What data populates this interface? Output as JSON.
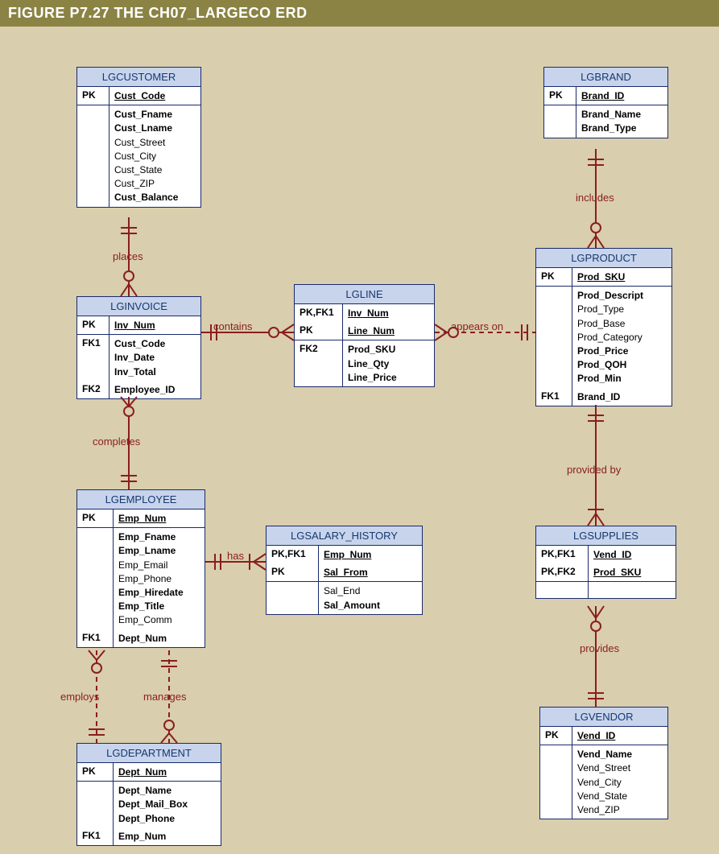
{
  "title": "FIGURE P7.27  THE CH07_LARGECO ERD",
  "entities": {
    "lgcustomer": {
      "name": "LGCUSTOMER",
      "pk": {
        "key": "PK",
        "attr": "Cust_Code"
      },
      "body": [
        {
          "key": "",
          "attrs": [
            {
              "t": "Cust_Fname",
              "b": true
            },
            {
              "t": "Cust_Lname",
              "b": true
            },
            {
              "t": "Cust_Street"
            },
            {
              "t": "Cust_City"
            },
            {
              "t": "Cust_State"
            },
            {
              "t": "Cust_ZIP"
            },
            {
              "t": "Cust_Balance",
              "b": true
            }
          ]
        }
      ]
    },
    "lginvoice": {
      "name": "LGINVOICE",
      "pk": {
        "key": "PK",
        "attr": "Inv_Num"
      },
      "body": [
        {
          "key": "FK1",
          "attrs": [
            {
              "t": "Cust_Code",
              "b": true
            },
            {
              "t": "Inv_Date",
              "b": true
            },
            {
              "t": "Inv_Total",
              "b": true
            }
          ]
        },
        {
          "key": "FK2",
          "attrs": [
            {
              "t": "Employee_ID",
              "b": true
            }
          ]
        }
      ]
    },
    "lgline": {
      "name": "LGLINE",
      "pk": [
        {
          "key": "PK,FK1",
          "attr": "Inv_Num"
        },
        {
          "key": "PK",
          "attr": "Line_Num"
        }
      ],
      "body": [
        {
          "key": "FK2",
          "attrs": [
            {
              "t": "Prod_SKU",
              "b": true
            },
            {
              "t": "Line_Qty",
              "b": true
            },
            {
              "t": "Line_Price",
              "b": true
            }
          ]
        }
      ]
    },
    "lgbrand": {
      "name": "LGBRAND",
      "pk": {
        "key": "PK",
        "attr": "Brand_ID"
      },
      "body": [
        {
          "key": "",
          "attrs": [
            {
              "t": "Brand_Name",
              "b": true
            },
            {
              "t": "Brand_Type",
              "b": true
            }
          ]
        }
      ]
    },
    "lgproduct": {
      "name": "LGPRODUCT",
      "pk": {
        "key": "PK",
        "attr": "Prod_SKU"
      },
      "body": [
        {
          "key": "",
          "attrs": [
            {
              "t": "Prod_Descript",
              "b": true
            },
            {
              "t": "Prod_Type"
            },
            {
              "t": "Prod_Base"
            },
            {
              "t": "Prod_Category"
            },
            {
              "t": "Prod_Price",
              "b": true
            },
            {
              "t": "Prod_QOH",
              "b": true
            },
            {
              "t": "Prod_Min",
              "b": true
            }
          ]
        },
        {
          "key": "FK1",
          "attrs": [
            {
              "t": "Brand_ID",
              "b": true
            }
          ]
        }
      ]
    },
    "lgemployee": {
      "name": "LGEMPLOYEE",
      "pk": {
        "key": "PK",
        "attr": "Emp_Num"
      },
      "body": [
        {
          "key": "",
          "attrs": [
            {
              "t": "Emp_Fname",
              "b": true
            },
            {
              "t": "Emp_Lname",
              "b": true
            },
            {
              "t": "Emp_Email"
            },
            {
              "t": "Emp_Phone"
            },
            {
              "t": "Emp_Hiredate",
              "b": true
            },
            {
              "t": "Emp_Title",
              "b": true
            },
            {
              "t": "Emp_Comm"
            }
          ]
        },
        {
          "key": "FK1",
          "attrs": [
            {
              "t": "Dept_Num",
              "b": true
            }
          ]
        }
      ]
    },
    "lgsalary_history": {
      "name": "LGSALARY_HISTORY",
      "pk": [
        {
          "key": "PK,FK1",
          "attr": "Emp_Num"
        },
        {
          "key": "PK",
          "attr": "Sal_From"
        }
      ],
      "body": [
        {
          "key": "",
          "attrs": [
            {
              "t": "Sal_End"
            },
            {
              "t": "Sal_Amount",
              "b": true
            }
          ]
        }
      ]
    },
    "lgsupplies": {
      "name": "LGSUPPLIES",
      "pk": [
        {
          "key": "PK,FK1",
          "attr": "Vend_ID"
        },
        {
          "key": "PK,FK2",
          "attr": "Prod_SKU"
        }
      ],
      "body": [
        {
          "key": "",
          "attrs": [
            {
              "t": " "
            }
          ]
        }
      ]
    },
    "lgvendor": {
      "name": "LGVENDOR",
      "pk": {
        "key": "PK",
        "attr": "Vend_ID"
      },
      "body": [
        {
          "key": "",
          "attrs": [
            {
              "t": "Vend_Name",
              "b": true
            },
            {
              "t": "Vend_Street"
            },
            {
              "t": "Vend_City"
            },
            {
              "t": "Vend_State"
            },
            {
              "t": "Vend_ZIP"
            }
          ]
        }
      ]
    },
    "lgdepartment": {
      "name": "LGDEPARTMENT",
      "pk": {
        "key": "PK",
        "attr": "Dept_Num"
      },
      "body": [
        {
          "key": "",
          "attrs": [
            {
              "t": "Dept_Name",
              "b": true
            },
            {
              "t": "Dept_Mail_Box",
              "b": true
            },
            {
              "t": "Dept_Phone",
              "b": true
            }
          ]
        },
        {
          "key": "FK1",
          "attrs": [
            {
              "t": "Emp_Num",
              "b": true
            }
          ]
        }
      ]
    }
  },
  "relationships": {
    "places": "places",
    "contains": "contains",
    "appears_on": "appears on",
    "includes": "includes",
    "completes": "completes",
    "has": "has",
    "employs": "employs",
    "manages": "manages",
    "provided_by": "provided by",
    "provides": "provides"
  }
}
